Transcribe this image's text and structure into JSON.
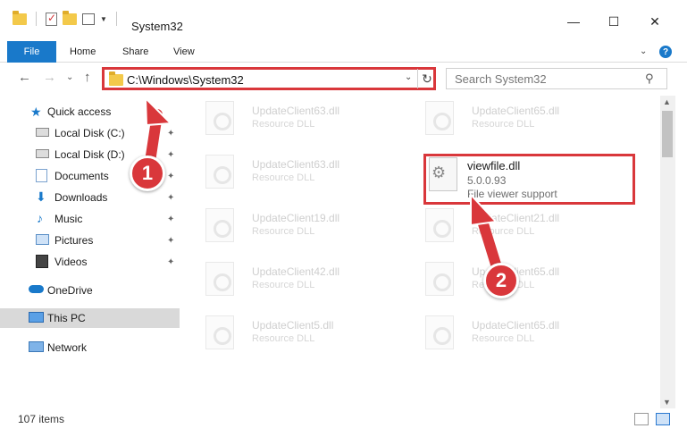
{
  "window": {
    "title": "System32",
    "minimize_glyph": "—",
    "maximize_glyph": "☐",
    "close_glyph": "✕"
  },
  "ribbon": {
    "tabs": [
      "File",
      "Home",
      "Share",
      "View"
    ],
    "expand_glyph": "⌄",
    "help_glyph": "?"
  },
  "nav": {
    "back_glyph": "←",
    "forward_glyph": "→",
    "recent_glyph": "⌄",
    "up_glyph": "↑",
    "address": "C:\\Windows\\System32",
    "address_dropdown_glyph": "⌄",
    "refresh_glyph": "↻",
    "search_placeholder": "Search System32",
    "search_glyph": "⚲"
  },
  "sidebar": {
    "items": [
      {
        "label": "Quick access",
        "icon": "star-icon"
      },
      {
        "label": "Local Disk (C:)",
        "icon": "drive-icon"
      },
      {
        "label": "Local Disk (D:)",
        "icon": "drive-icon"
      },
      {
        "label": "Documents",
        "icon": "documents-icon"
      },
      {
        "label": "Downloads",
        "icon": "downloads-icon"
      },
      {
        "label": "Music",
        "icon": "music-icon"
      },
      {
        "label": "Pictures",
        "icon": "pictures-icon"
      },
      {
        "label": "Videos",
        "icon": "videos-icon"
      },
      {
        "label": "OneDrive",
        "icon": "cloud-icon"
      },
      {
        "label": "This PC",
        "icon": "computer-icon"
      },
      {
        "label": "Network",
        "icon": "network-icon"
      }
    ],
    "pin_glyph": "📌"
  },
  "files": [
    {
      "name": "UpdateClient63.dll",
      "desc": "Resource DLL"
    },
    {
      "name": "UpdateClient65.dll",
      "desc": "Resource DLL"
    },
    {
      "name": "UpdateClient63.dll",
      "desc": "Resource DLL"
    },
    {
      "name": "UpdateClient19.dll",
      "desc": "Resource DLL"
    },
    {
      "name": "UpdateClient21.dll",
      "desc": "Resource DLL"
    },
    {
      "name": "UpdateClient42.dll",
      "desc": "Resource DLL"
    },
    {
      "name": "UpdateClient65.dll",
      "desc": "Resource DLL"
    },
    {
      "name": "UpdateClient5.dll",
      "desc": "Resource DLL"
    },
    {
      "name": "UpdateClient65.dll",
      "desc": "Resource DLL"
    }
  ],
  "highlighted_file": {
    "name": "viewfile.dll",
    "version": "5.0.0.93",
    "description": "File viewer support"
  },
  "status": {
    "item_count": "107 items"
  },
  "callouts": {
    "one": "1",
    "two": "2"
  },
  "colors": {
    "accent": "#1979ca",
    "annotation_red": "#d9373b"
  }
}
